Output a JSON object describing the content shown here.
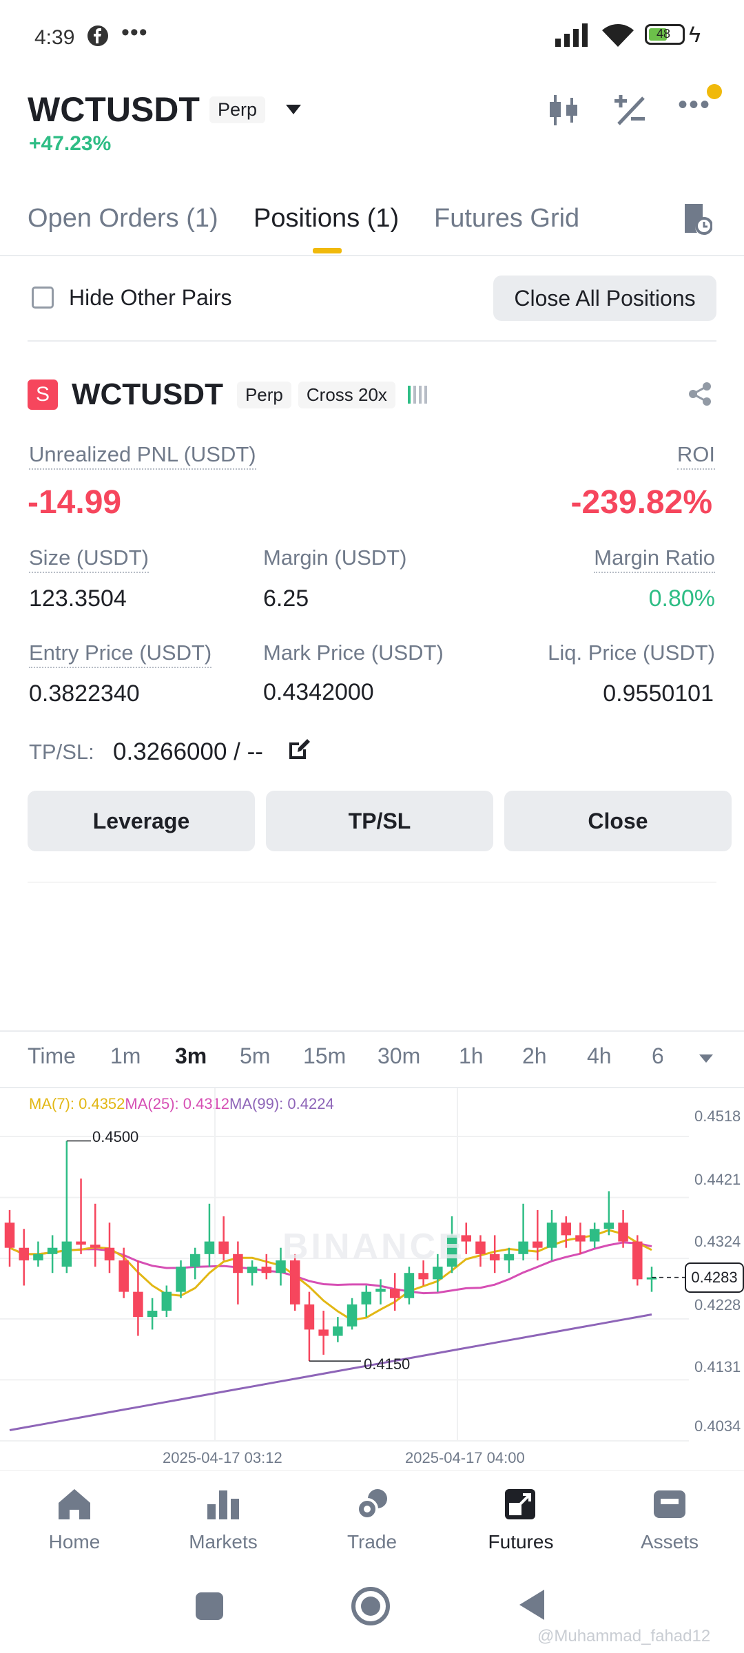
{
  "status": {
    "time": "4:39",
    "battery": "48"
  },
  "header": {
    "symbol": "WCTUSDT",
    "type": "Perp",
    "change": "+47.23%"
  },
  "tabs": [
    {
      "label": "Open Orders (1)"
    },
    {
      "label": "Positions (1)"
    },
    {
      "label": "Futures Grid"
    }
  ],
  "filters": {
    "hide_label": "Hide Other Pairs",
    "close_all": "Close All Positions"
  },
  "position": {
    "badge": "S",
    "symbol": "WCTUSDT",
    "type": "Perp",
    "margin_mode": "Cross 20x",
    "pnl_label": "Unrealized PNL (USDT)",
    "pnl_value": "-14.99",
    "roi_label": "ROI",
    "roi_value": "-239.82%",
    "size_label": "Size (USDT)",
    "size_value": "123.3504",
    "margin_label": "Margin (USDT)",
    "margin_value": "6.25",
    "ratio_label": "Margin Ratio",
    "ratio_value": "0.80%",
    "entry_label": "Entry Price (USDT)",
    "entry_value": "0.3822340",
    "mark_label": "Mark Price (USDT)",
    "mark_value": "0.4342000",
    "liq_label": "Liq. Price (USDT)",
    "liq_value": "0.9550101",
    "tpsl_label": "TP/SL:",
    "tpsl_value": "0.3266000 / --"
  },
  "actions": {
    "leverage": "Leverage",
    "tpsl": "TP/SL",
    "close": "Close"
  },
  "timeframes": [
    "Time",
    "1m",
    "3m",
    "5m",
    "15m",
    "30m",
    "1h",
    "2h",
    "4h",
    "6"
  ],
  "ma": {
    "ma7": "MA(7): 0.4352",
    "ma25": "MA(25): 0.4312",
    "ma99": "MA(99): 0.4224"
  },
  "chart_data": {
    "type": "candlestick",
    "y_ticks": [
      "0.4518",
      "0.4421",
      "0.4324",
      "0.4228",
      "0.4131",
      "0.4034"
    ],
    "x_ticks": [
      "2025-04-17 03:12",
      "2025-04-17 04:00"
    ],
    "high_label": "0.4500",
    "low_label": "0.4150",
    "last_price": "0.4283",
    "watermark": "BINANCE",
    "colors": {
      "up": "#2ebd85",
      "down": "#f6465d",
      "ma7": "#e2b714",
      "ma25": "#d64fb4",
      "ma99": "#8e65b8"
    },
    "candles": [
      {
        "o": 0.437,
        "h": 0.439,
        "l": 0.43,
        "c": 0.433
      },
      {
        "o": 0.433,
        "h": 0.436,
        "l": 0.427,
        "c": 0.431
      },
      {
        "o": 0.431,
        "h": 0.434,
        "l": 0.43,
        "c": 0.432
      },
      {
        "o": 0.432,
        "h": 0.435,
        "l": 0.429,
        "c": 0.433
      },
      {
        "o": 0.43,
        "h": 0.45,
        "l": 0.429,
        "c": 0.434
      },
      {
        "o": 0.434,
        "h": 0.444,
        "l": 0.432,
        "c": 0.4335
      },
      {
        "o": 0.4335,
        "h": 0.44,
        "l": 0.43,
        "c": 0.433
      },
      {
        "o": 0.433,
        "h": 0.437,
        "l": 0.429,
        "c": 0.431
      },
      {
        "o": 0.431,
        "h": 0.433,
        "l": 0.425,
        "c": 0.426
      },
      {
        "o": 0.426,
        "h": 0.431,
        "l": 0.419,
        "c": 0.422
      },
      {
        "o": 0.422,
        "h": 0.425,
        "l": 0.42,
        "c": 0.423
      },
      {
        "o": 0.423,
        "h": 0.427,
        "l": 0.422,
        "c": 0.426
      },
      {
        "o": 0.426,
        "h": 0.431,
        "l": 0.425,
        "c": 0.43
      },
      {
        "o": 0.43,
        "h": 0.433,
        "l": 0.428,
        "c": 0.432
      },
      {
        "o": 0.432,
        "h": 0.44,
        "l": 0.43,
        "c": 0.434
      },
      {
        "o": 0.434,
        "h": 0.438,
        "l": 0.431,
        "c": 0.432
      },
      {
        "o": 0.432,
        "h": 0.434,
        "l": 0.424,
        "c": 0.429
      },
      {
        "o": 0.429,
        "h": 0.431,
        "l": 0.427,
        "c": 0.43
      },
      {
        "o": 0.43,
        "h": 0.432,
        "l": 0.428,
        "c": 0.429
      },
      {
        "o": 0.429,
        "h": 0.433,
        "l": 0.427,
        "c": 0.431
      },
      {
        "o": 0.431,
        "h": 0.432,
        "l": 0.423,
        "c": 0.424
      },
      {
        "o": 0.424,
        "h": 0.426,
        "l": 0.415,
        "c": 0.42
      },
      {
        "o": 0.42,
        "h": 0.423,
        "l": 0.416,
        "c": 0.419
      },
      {
        "o": 0.419,
        "h": 0.422,
        "l": 0.418,
        "c": 0.4205
      },
      {
        "o": 0.4205,
        "h": 0.425,
        "l": 0.42,
        "c": 0.424
      },
      {
        "o": 0.424,
        "h": 0.427,
        "l": 0.422,
        "c": 0.426
      },
      {
        "o": 0.426,
        "h": 0.428,
        "l": 0.424,
        "c": 0.4265
      },
      {
        "o": 0.4265,
        "h": 0.429,
        "l": 0.423,
        "c": 0.425
      },
      {
        "o": 0.425,
        "h": 0.43,
        "l": 0.424,
        "c": 0.429
      },
      {
        "o": 0.429,
        "h": 0.431,
        "l": 0.427,
        "c": 0.428
      },
      {
        "o": 0.428,
        "h": 0.432,
        "l": 0.426,
        "c": 0.43
      },
      {
        "o": 0.43,
        "h": 0.438,
        "l": 0.429,
        "c": 0.435
      },
      {
        "o": 0.435,
        "h": 0.437,
        "l": 0.432,
        "c": 0.434
      },
      {
        "o": 0.434,
        "h": 0.435,
        "l": 0.43,
        "c": 0.432
      },
      {
        "o": 0.432,
        "h": 0.435,
        "l": 0.429,
        "c": 0.431
      },
      {
        "o": 0.431,
        "h": 0.433,
        "l": 0.429,
        "c": 0.432
      },
      {
        "o": 0.432,
        "h": 0.44,
        "l": 0.431,
        "c": 0.434
      },
      {
        "o": 0.434,
        "h": 0.439,
        "l": 0.431,
        "c": 0.433
      },
      {
        "o": 0.433,
        "h": 0.439,
        "l": 0.431,
        "c": 0.437
      },
      {
        "o": 0.437,
        "h": 0.438,
        "l": 0.433,
        "c": 0.435
      },
      {
        "o": 0.435,
        "h": 0.437,
        "l": 0.432,
        "c": 0.434
      },
      {
        "o": 0.434,
        "h": 0.437,
        "l": 0.433,
        "c": 0.436
      },
      {
        "o": 0.436,
        "h": 0.442,
        "l": 0.435,
        "c": 0.437
      },
      {
        "o": 0.437,
        "h": 0.439,
        "l": 0.433,
        "c": 0.434
      },
      {
        "o": 0.434,
        "h": 0.435,
        "l": 0.427,
        "c": 0.428
      },
      {
        "o": 0.428,
        "h": 0.43,
        "l": 0.426,
        "c": 0.4283
      }
    ]
  },
  "nav": [
    {
      "label": "Home",
      "icon": "home-icon"
    },
    {
      "label": "Markets",
      "icon": "bar-chart-icon"
    },
    {
      "label": "Trade",
      "icon": "trade-icon"
    },
    {
      "label": "Futures",
      "icon": "futures-icon"
    },
    {
      "label": "Assets",
      "icon": "wallet-icon"
    }
  ],
  "watermark_text": "@Muhammad_fahad12"
}
